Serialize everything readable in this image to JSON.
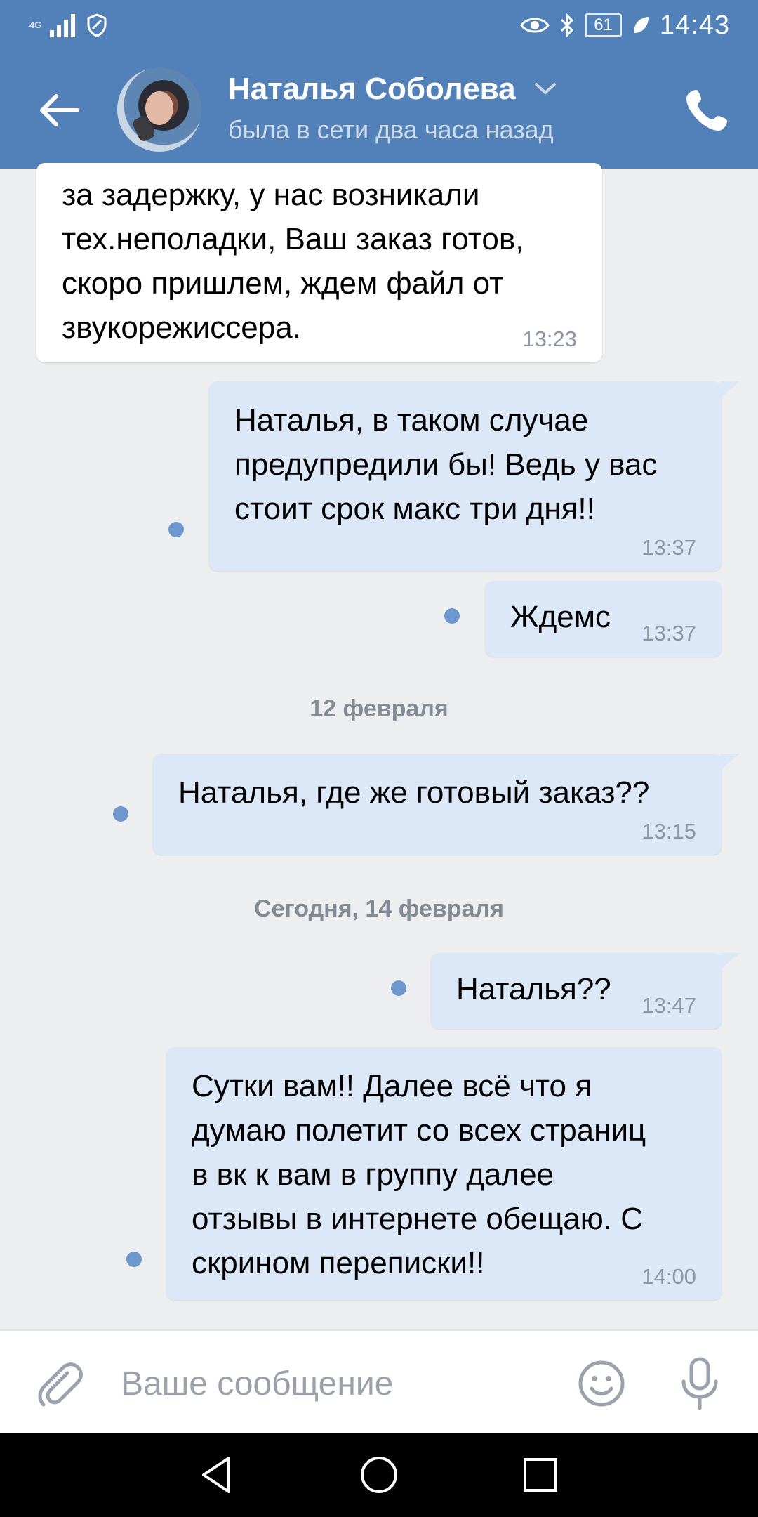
{
  "status_bar": {
    "network": "4G",
    "battery": "61",
    "time": "14:43",
    "icons": [
      "signal-icon",
      "vpn-shield-icon",
      "eye-icon",
      "bluetooth-icon",
      "battery-icon",
      "leaf-icon"
    ]
  },
  "header": {
    "contact_name": "Наталья Соболева",
    "status": "была в сети два часа назад",
    "accent_color": "#5181b8"
  },
  "messages": [
    {
      "direction": "in",
      "text": "за задержку, у нас возникали\nтех.неполадки, Ваш заказ готов,\nскоро пришлем, ждем файл от\nзвукорежиссера.",
      "time": "13:23"
    },
    {
      "direction": "out",
      "text": "Наталья, в таком случае\nпредупредили бы! Ведь у вас\nстоит срок макс три дня!!",
      "time": "13:37",
      "unread": true
    },
    {
      "direction": "out",
      "text": "Ждемс",
      "time": "13:37",
      "unread": true
    },
    {
      "type": "date",
      "text": "12 февраля"
    },
    {
      "direction": "out",
      "text": "Наталья, где же готовый заказ??",
      "time": "13:15",
      "unread": true
    },
    {
      "type": "date",
      "text": "Сегодня, 14 февраля"
    },
    {
      "direction": "out",
      "text": "Наталья??",
      "time": "13:47",
      "unread": true
    },
    {
      "direction": "out",
      "text": "Сутки вам!! Далее всё что я\nдумаю полетит со всех страниц\nв вк к вам в группу далее\nотзывы в интернете обещаю. С\nскрином переписки!!",
      "time": "14:00",
      "unread": true
    }
  ],
  "input": {
    "placeholder": "Ваше сообщение",
    "value": ""
  },
  "colors": {
    "outgoing_bubble": "#dce8f7",
    "incoming_bubble": "#ffffff",
    "unread_dot": "#6e98cd",
    "background": "#edeef0"
  }
}
